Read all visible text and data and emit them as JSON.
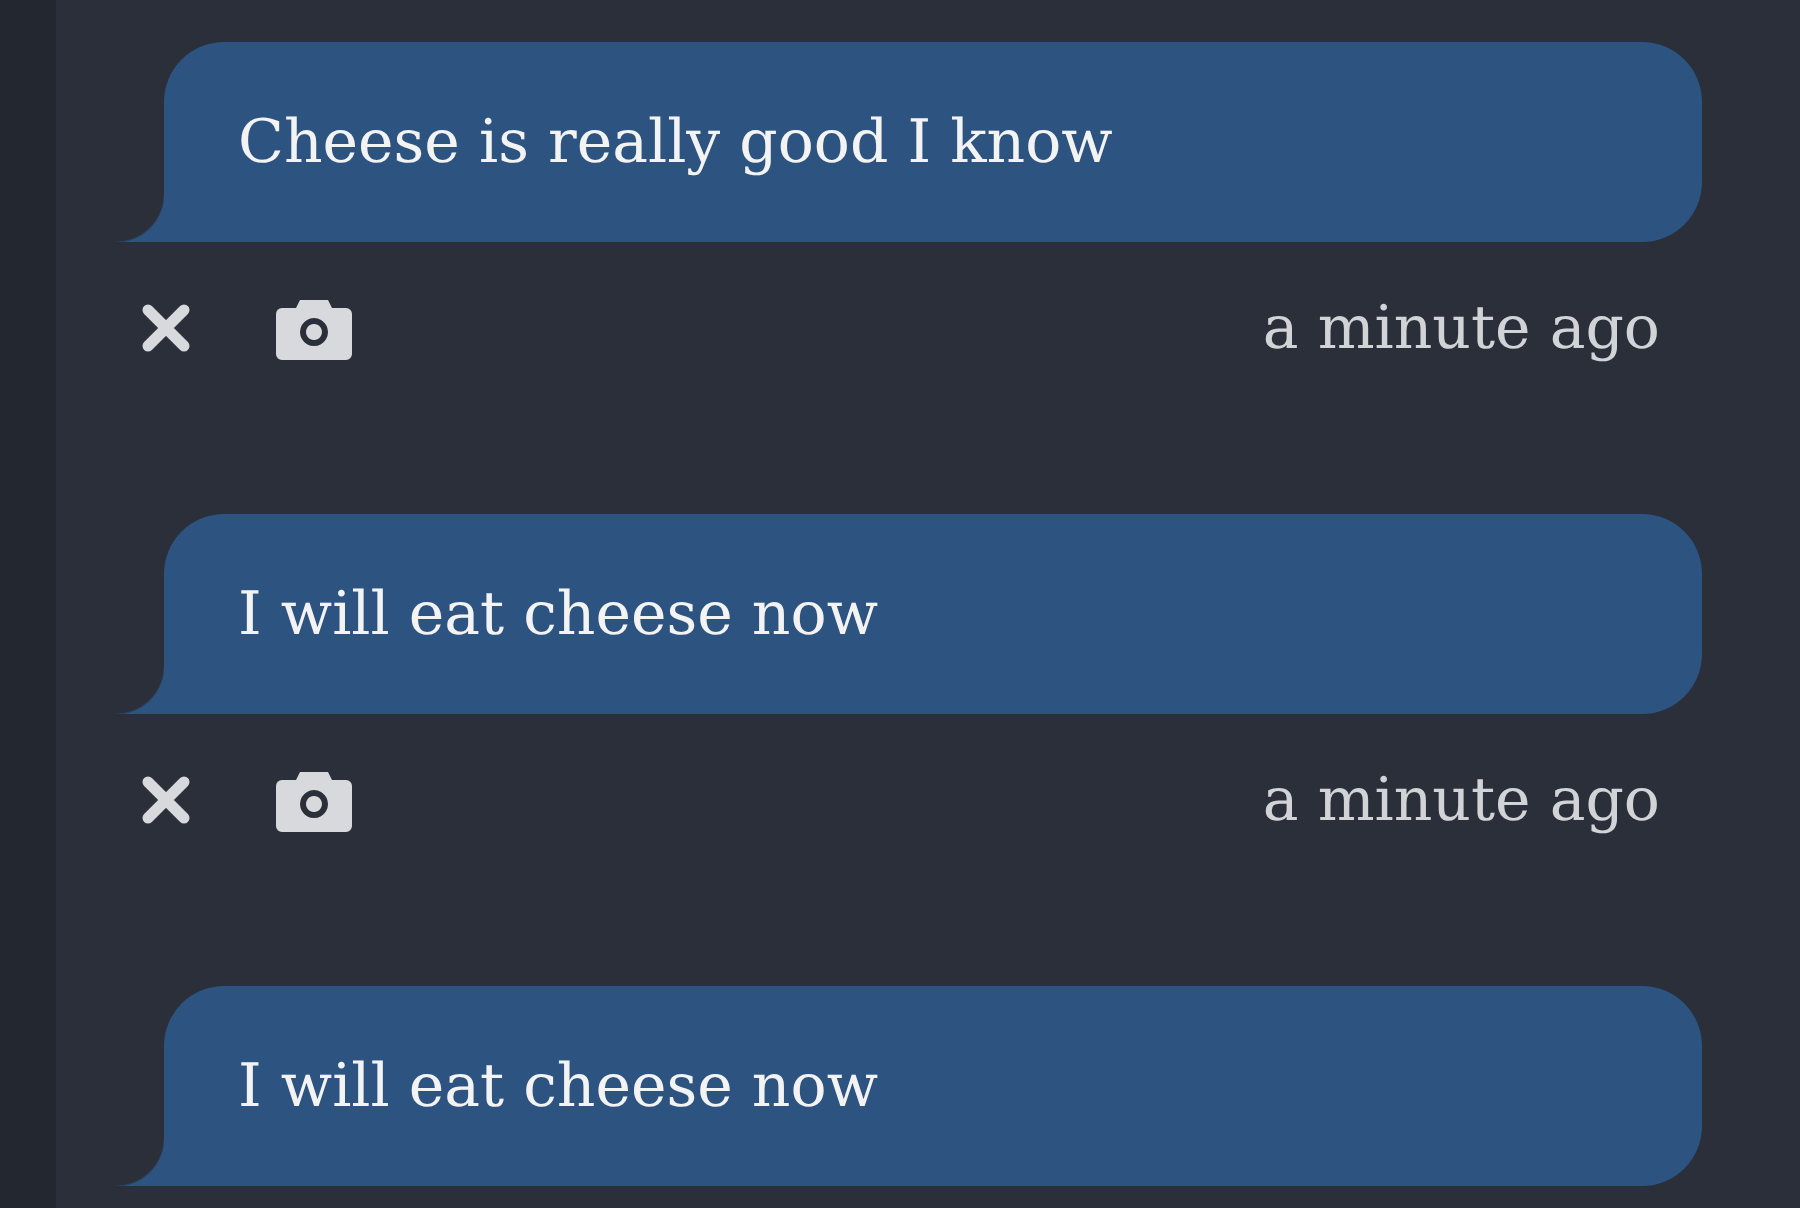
{
  "messages": [
    {
      "text": "Cheese is really good I know",
      "time": "a minute ago"
    },
    {
      "text": "I will eat cheese now",
      "time": "a minute ago"
    },
    {
      "text": "I will eat cheese now"
    }
  ]
}
